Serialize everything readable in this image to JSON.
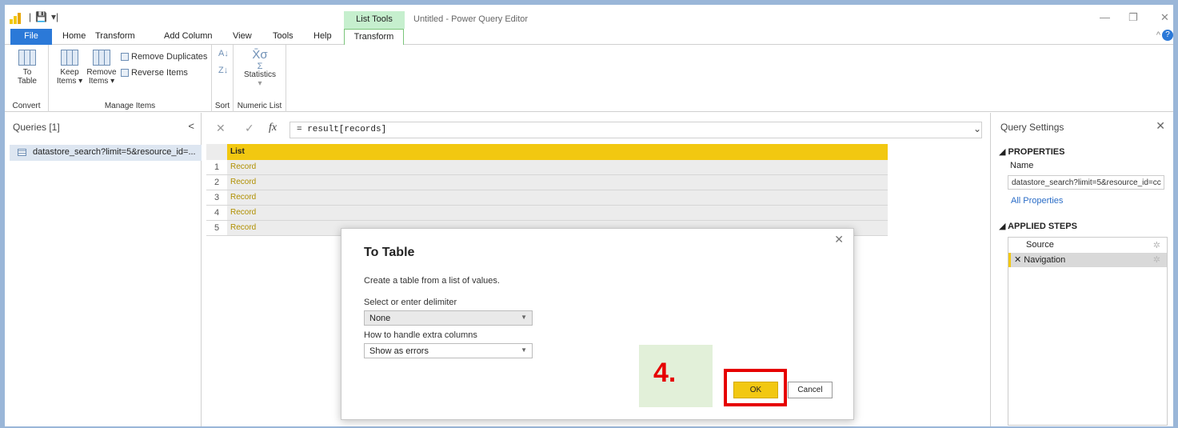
{
  "window": {
    "title": "Untitled - Power Query Editor",
    "context_tab_header": "List Tools"
  },
  "tabs": [
    "File",
    "Home",
    "Transform",
    "Add Column",
    "View",
    "Tools",
    "Help",
    "Transform"
  ],
  "ribbon": {
    "convert": {
      "to_table_line1": "To",
      "to_table_line2": "Table",
      "group_label": "Convert"
    },
    "manage": {
      "keep_line1": "Keep",
      "keep_line2": "Items ▾",
      "remove_line1": "Remove",
      "remove_line2": "Items ▾",
      "remove_duplicates": "Remove Duplicates",
      "reverse_items": "Reverse Items",
      "group_label": "Manage Items"
    },
    "sort": {
      "group_label": "Sort"
    },
    "numeric": {
      "statistics": "Statistics",
      "group_label": "Numeric List"
    }
  },
  "queries": {
    "header": "Queries [1]",
    "items": [
      "datastore_search?limit=5&resource_id=..."
    ]
  },
  "formula": {
    "text": "= result[records]"
  },
  "grid": {
    "column": "List",
    "rows": [
      {
        "n": "1",
        "v": "Record"
      },
      {
        "n": "2",
        "v": "Record"
      },
      {
        "n": "3",
        "v": "Record"
      },
      {
        "n": "4",
        "v": "Record"
      },
      {
        "n": "5",
        "v": "Record"
      }
    ]
  },
  "settings": {
    "header": "Query Settings",
    "properties_label": "PROPERTIES",
    "name_label": "Name",
    "name_value": "datastore_search?limit=5&resource_id=cc",
    "all_properties": "All Properties",
    "applied_steps_label": "APPLIED STEPS",
    "steps": [
      "Source",
      "Navigation"
    ]
  },
  "dialog": {
    "title": "To Table",
    "description": "Create a table from a list of values.",
    "delimiter_label": "Select or enter delimiter",
    "delimiter_value": "None",
    "extra_columns_label": "How to handle extra columns",
    "extra_columns_value": "Show as errors",
    "ok_label": "OK",
    "cancel_label": "Cancel"
  },
  "annotation": {
    "step_number": "4."
  },
  "colors": {
    "accent_yellow": "#f2c811",
    "file_blue": "#2b79d8",
    "annotation_red": "#e60000",
    "annotation_green": "#e2f0d9"
  }
}
